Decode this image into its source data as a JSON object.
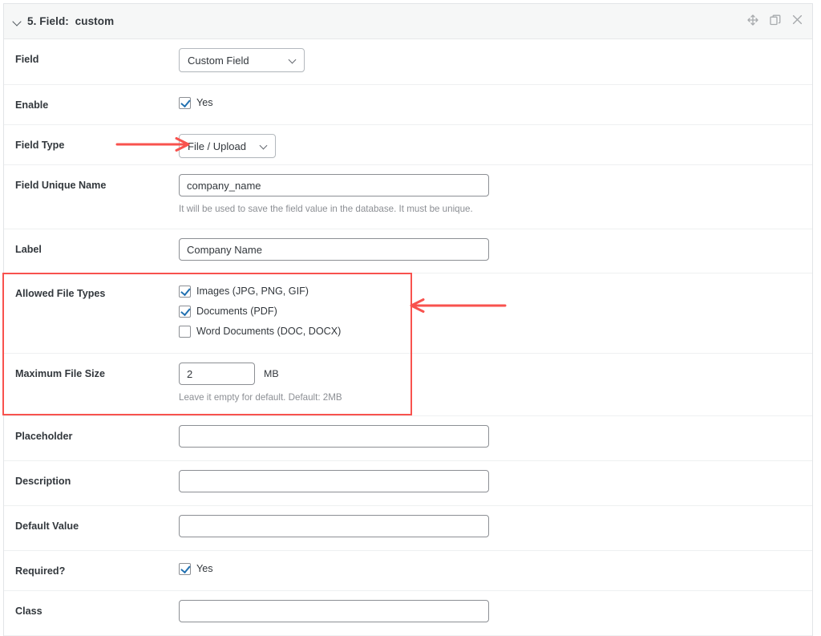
{
  "header": {
    "toggle_icon": "chevron-down-icon",
    "title": "5. Field:  custom",
    "actions": [
      {
        "name": "move-handle-icon",
        "label": "Move"
      },
      {
        "name": "duplicate-icon",
        "label": "Duplicate"
      },
      {
        "name": "close-icon",
        "label": "Close"
      }
    ]
  },
  "accent": {
    "annotation_red": "#f8524e",
    "checkbox_blue": "#2271b1"
  },
  "rows": {
    "field": {
      "label": "Field",
      "select_value": "Custom Field",
      "caret_icon": "chevron-down-icon"
    },
    "enable": {
      "label": "Enable",
      "checkbox_label": "Yes",
      "checked": true
    },
    "field_type": {
      "label": "Field Type",
      "select_value": "File / Upload",
      "caret_icon": "chevron-down-icon"
    },
    "field_unique_name": {
      "label": "Field Unique Name",
      "value": "company_name",
      "placeholder": "",
      "help": "It will be used to save the field value in the database. It must be unique."
    },
    "label_row": {
      "label": "Label",
      "value": "Company Name",
      "placeholder": ""
    },
    "allowed_file_types": {
      "label": "Allowed File Types",
      "options": [
        {
          "label": "Images (JPG, PNG, GIF)",
          "checked": true
        },
        {
          "label": "Documents (PDF)",
          "checked": true
        },
        {
          "label": "Word Documents (DOC, DOCX)",
          "checked": false
        }
      ]
    },
    "maximum_file_size": {
      "label": "Maximum File Size",
      "value": "2",
      "placeholder": "",
      "unit": "MB",
      "help": "Leave it empty for default. Default: 2MB"
    },
    "placeholder_row": {
      "label": "Placeholder",
      "value": "",
      "placeholder": ""
    },
    "description": {
      "label": "Description",
      "value": "",
      "placeholder": ""
    },
    "default_value": {
      "label": "Default Value",
      "value": "",
      "placeholder": ""
    },
    "required": {
      "label": "Required?",
      "checkbox_label": "Yes",
      "checked": true
    },
    "class_row": {
      "label": "Class",
      "value": "",
      "placeholder": ""
    }
  }
}
